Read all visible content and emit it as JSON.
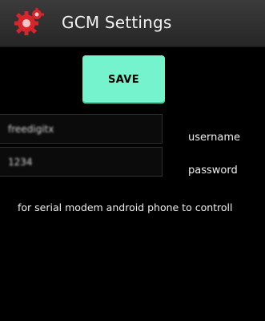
{
  "app": {
    "title": "GCM Settings",
    "icon": "gear-icon"
  },
  "actions": {
    "save_label": "SAVE"
  },
  "form": {
    "username": {
      "value": "freedigitx",
      "label": "username"
    },
    "password": {
      "value": "1234",
      "label": "password"
    }
  },
  "note": "for serial modem android phone to controll",
  "colors": {
    "action_bar": "#2f2f2f",
    "save_button": "#74f3cc",
    "icon_red": "#d8242b",
    "background": "#000000"
  }
}
